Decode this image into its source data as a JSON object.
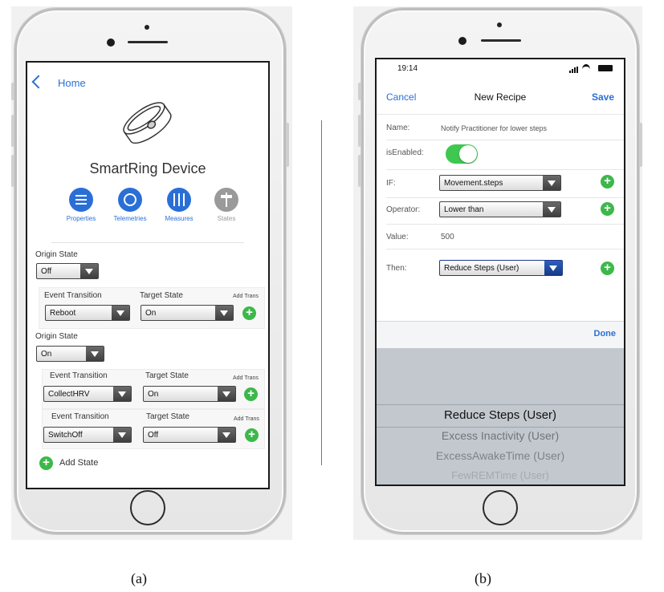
{
  "captions": {
    "a": "(a)",
    "b": "(b)"
  },
  "screen_a": {
    "nav": {
      "back_label": "Home"
    },
    "device_name": "SmartRing Device",
    "tabs": [
      {
        "label": "Properties",
        "icon": "list-icon"
      },
      {
        "label": "Telemetries",
        "icon": "clock-icon"
      },
      {
        "label": "Measures",
        "icon": "sliders-icon"
      },
      {
        "label": "States",
        "icon": "signpost-icon"
      }
    ],
    "states": [
      {
        "origin_label": "Origin State",
        "origin_value": "Off",
        "transitions": [
          {
            "event_label": "Event Transition",
            "event_value": "Reboot",
            "target_label": "Target State",
            "target_value": "On",
            "add_label": "Add Trans"
          }
        ]
      },
      {
        "origin_label": "Origin State",
        "origin_value": "On",
        "transitions": [
          {
            "event_label": "Event Transition",
            "event_value": "CollectHRV",
            "target_label": "Target State",
            "target_value": "On",
            "add_label": "Add Trans"
          },
          {
            "event_label": "Event Transition",
            "event_value": "SwitchOff",
            "target_label": "Target State",
            "target_value": "Off",
            "add_label": "Add Trans"
          }
        ]
      }
    ],
    "add_state_label": "Add State"
  },
  "screen_b": {
    "status_bar": {
      "time": "19:14"
    },
    "nav": {
      "cancel": "Cancel",
      "title": "New Recipe",
      "save": "Save"
    },
    "form": {
      "name_label": "Name:",
      "name_value": "Notify Practitioner for lower steps",
      "enabled_label": "isEnabled:",
      "enabled": true,
      "if_label": "IF:",
      "if_value": "Movement.steps",
      "operator_label": "Operator:",
      "operator_value": "Lower than",
      "value_label": "Value:",
      "value_value": "500",
      "then_label": "Then:",
      "then_value": "Reduce Steps (User)"
    },
    "done_label": "Done",
    "picker_options": [
      "Reduce Steps (User)",
      "Excess Inactivity (User)",
      "ExcessAwakeTime (User)",
      "FewREMTime (User)"
    ]
  },
  "colors": {
    "ios_blue": "#2a6fd6",
    "add_green": "#3cb84a",
    "toggle_green": "#3fc84f",
    "picker_bg": "#c3c8cf"
  }
}
